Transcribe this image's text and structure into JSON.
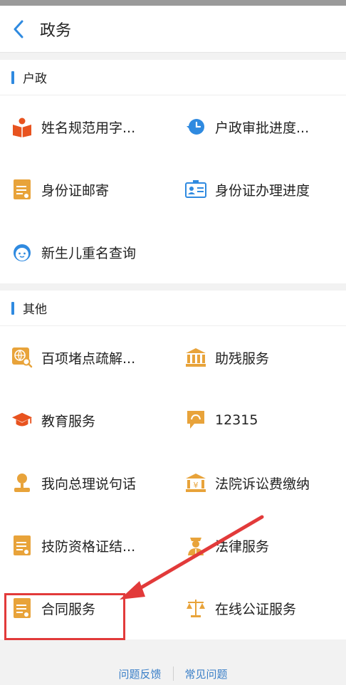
{
  "header": {
    "title": "政务"
  },
  "sections": [
    {
      "title": "户政",
      "items": [
        {
          "label": "姓名规范用字...",
          "icon": "book-person-icon"
        },
        {
          "label": "户政审批进度...",
          "icon": "clock-history-icon"
        },
        {
          "label": "身份证邮寄",
          "icon": "document-icon"
        },
        {
          "label": "身份证办理进度",
          "icon": "id-card-icon"
        },
        {
          "label": "新生儿重名查询",
          "icon": "baby-face-icon"
        }
      ]
    },
    {
      "title": "其他",
      "items": [
        {
          "label": "百项堵点疏解...",
          "icon": "search-globe-icon"
        },
        {
          "label": "助残服务",
          "icon": "building-icon"
        },
        {
          "label": "教育服务",
          "icon": "graduation-cap-icon"
        },
        {
          "label": "12315",
          "icon": "chat-bubble-icon"
        },
        {
          "label": "我向总理说句话",
          "icon": "microphone-person-icon"
        },
        {
          "label": "法院诉讼费缴纳",
          "icon": "court-fee-icon"
        },
        {
          "label": "技防资格证结...",
          "icon": "document-icon"
        },
        {
          "label": "法律服务",
          "icon": "law-officer-icon"
        },
        {
          "label": "合同服务",
          "icon": "document-icon"
        },
        {
          "label": "在线公证服务",
          "icon": "scales-icon"
        }
      ]
    }
  ],
  "footer": {
    "feedback": "问题反馈",
    "faq": "常见问题"
  },
  "colors": {
    "accent": "#2f8ae0",
    "icon_orange": "#e8a33a",
    "highlight": "#e23a3a"
  }
}
